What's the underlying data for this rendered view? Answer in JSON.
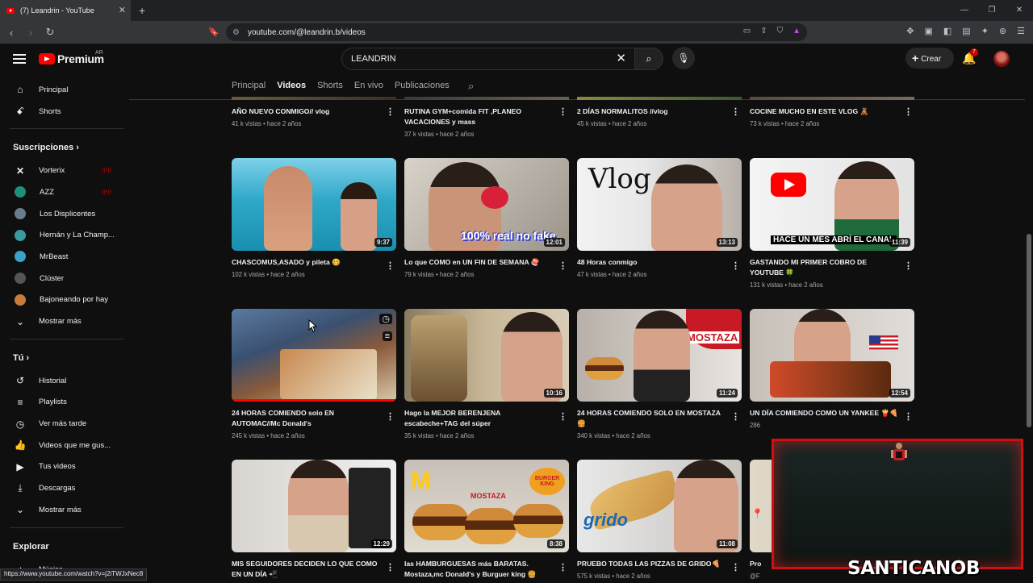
{
  "browser": {
    "tab_title": "(7) Leandrin - YouTube",
    "url": "youtube.com/@leandrin.b/videos",
    "status_url": "https://www.youtube.com/watch?v=j2iTWJxNec8"
  },
  "header": {
    "logo_text": "Premium",
    "region": "AR",
    "search_value": "LEANDRIN",
    "create_label": "Crear",
    "notif_count": "7"
  },
  "sidebar": {
    "main": [
      {
        "label": "Principal",
        "icon": "home-icon"
      },
      {
        "label": "Shorts",
        "icon": "shorts-icon"
      }
    ],
    "subs_title": "Suscripciones",
    "subs": [
      {
        "label": "Vorterix",
        "color": "#1a1a1a"
      },
      {
        "label": "AZZ",
        "color": "#1f8f7a"
      },
      {
        "label": "Los Displicentes",
        "color": "#6a7d8c"
      },
      {
        "label": "Hernán y La Champ...",
        "color": "#3a9aa0"
      },
      {
        "label": "MrBeast",
        "color": "#3ba3c8"
      },
      {
        "label": "Clúster",
        "color": "#555555"
      },
      {
        "label": "Bajoneando por hay",
        "color": "#c87c3a"
      }
    ],
    "subs_more": "Mostrar más",
    "you_title": "Tú",
    "you": [
      {
        "label": "Historial"
      },
      {
        "label": "Playlists"
      },
      {
        "label": "Ver más tarde"
      },
      {
        "label": "Videos que me gus..."
      },
      {
        "label": "Tus videos"
      },
      {
        "label": "Descargas"
      },
      {
        "label": "Mostrar más"
      }
    ],
    "explore_title": "Explorar",
    "explore": [
      {
        "label": "Música"
      }
    ]
  },
  "channel_tabs": [
    "Principal",
    "Videos",
    "Shorts",
    "En vivo",
    "Publicaciones"
  ],
  "active_tab": "Videos",
  "videos": [
    {
      "title": "AÑO NUEVO CONMIGO// vlog",
      "meta": "41 k vistas • hace 2 años",
      "duration": ""
    },
    {
      "title": "RUTINA GYM+comida FIT ,PLANEO VACACIONES y mass",
      "meta": "37 k vistas • hace 2 años",
      "duration": ""
    },
    {
      "title": "2 DÍAS NORMALITOS //vlog",
      "meta": "45 k vistas • hace 2 años",
      "duration": ""
    },
    {
      "title": "COCINE MUCHO EN ESTE VLOG 🧸",
      "meta": "73 k vistas • hace 2 años",
      "duration": ""
    },
    {
      "title": "CHASCOMUS,ASADO y pileta 🥴",
      "meta": "102 k vistas • hace 2 años",
      "duration": "9:37"
    },
    {
      "title": "Lo que COMO en UN FIN DE SEMANA 🍣",
      "meta": "79 k vistas • hace 2 años",
      "duration": "12:01"
    },
    {
      "title": "48 Horas conmigo",
      "meta": "47 k vistas • hace 2 años",
      "duration": "13:13"
    },
    {
      "title": "GASTANDO MI PRIMER COBRO DE YOUTUBE 🍀",
      "meta": "131 k vistas • hace 2 años",
      "duration": "11:39"
    },
    {
      "title": "24 HORAS COMIENDO solo EN AUTOMAC//Mc Donald's",
      "meta": "245 k vistas • hace 2 años",
      "duration": ""
    },
    {
      "title": "Hago la MEJOR BERENJENA escabeche+TAG del súper",
      "meta": "35 k vistas • hace 2 años",
      "duration": "10:16"
    },
    {
      "title": "24 HORAS COMIENDO SOLO EN MOSTAZA 🍔",
      "meta": "340 k vistas • hace 2 años",
      "duration": "11:24"
    },
    {
      "title": "UN DÍA COMIENDO COMO UN YANKEE 🍟🍕",
      "meta": "286",
      "duration": "12:54"
    },
    {
      "title": "MIS SEGUIDORES DECIDEN LO QUE COMO EN UN DÍA 📲",
      "meta": "",
      "duration": "12:29"
    },
    {
      "title": "las HAMBURGUESAS más BARATAS. Mostaza,mc Donald's y Burguer king 🍔",
      "meta": "",
      "duration": "8:38"
    },
    {
      "title": "PRUEBO TODAS LAS PIZZAS DE GRIDO🍕",
      "meta": "575 k vistas • hace 2 años",
      "duration": "11:08"
    },
    {
      "title": "Pro",
      "meta": "@F",
      "duration": ""
    }
  ],
  "thumb_texts": {
    "t5": "100% real no fake",
    "t6": "Vlog",
    "t7": "HACE UN MES ABRÍ EL CANAL",
    "t10": "MOSTAZA",
    "t13": "MOSTAZA",
    "t13b": "BURGER KING",
    "t14": "grido"
  },
  "overlay": {
    "streamer": "SANTICANOB"
  }
}
